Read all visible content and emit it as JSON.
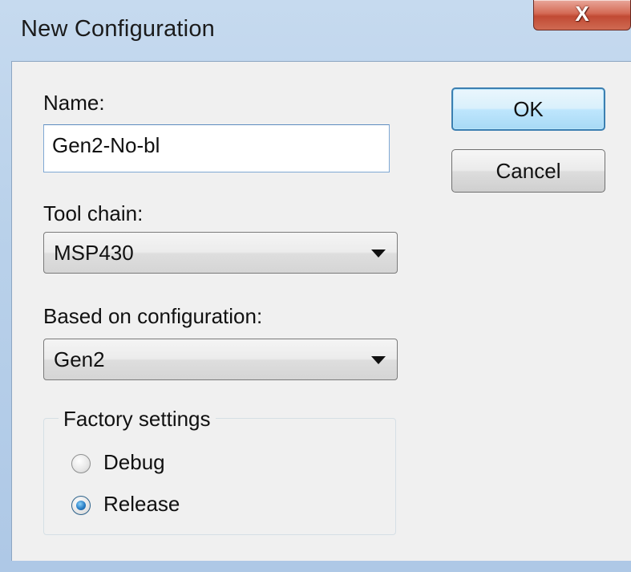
{
  "window": {
    "title": "New Configuration",
    "close_glyph": "X"
  },
  "fields": {
    "name_label": "Name:",
    "name_value": "Gen2-No-bl",
    "toolchain_label": "Tool chain:",
    "toolchain_value": "MSP430",
    "based_on_label": "Based on configuration:",
    "based_on_value": "Gen2"
  },
  "buttons": {
    "ok": "OK",
    "cancel": "Cancel"
  },
  "factory_settings": {
    "title": "Factory settings",
    "options": [
      {
        "label": "Debug",
        "checked": false
      },
      {
        "label": "Release",
        "checked": true
      }
    ]
  },
  "icons": {
    "close": "close-icon",
    "dropdown": "chevron-down-icon"
  },
  "colors": {
    "title_bar": "#b9d1ea",
    "client_bg": "#f0f0f0",
    "close_button": "#c14a34",
    "default_button_border": "#3c7fb1"
  }
}
